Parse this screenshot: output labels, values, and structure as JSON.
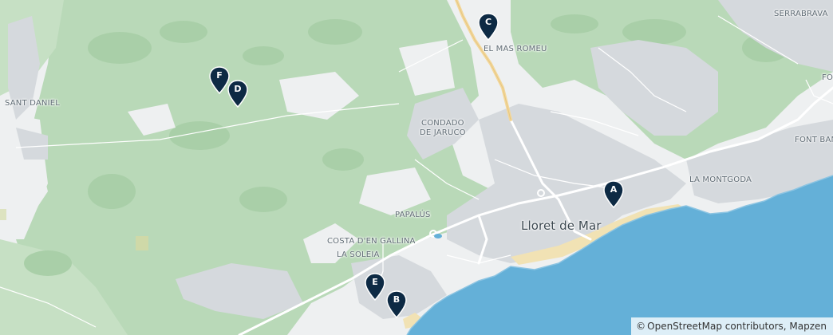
{
  "colors": {
    "land": "#eef0f1",
    "forest": "#b9d9b8",
    "forest_dark": "#a9cfa8",
    "water": "#64b0d8",
    "built": "#d5d9dd",
    "road_major": "#ffffff",
    "highway": "#f3d79a",
    "marker": "#0d2a44",
    "beach": "#f1e2b4"
  },
  "labels": {
    "el_mas_romeu": "EL MAS ROMEU",
    "serrabrava": "SERRABRAVA",
    "fo": "FO",
    "sant_daniel": "SANT DANIEL",
    "condado_line1": "CONDADO",
    "condado_line2": "DE JARUCO",
    "font_ban": "FONT BAN",
    "la_montgoda": "LA MONTGODA",
    "papalus": "PAPALÚS",
    "lloret": "Lloret de Mar",
    "costa_gallina": "COSTA D'EN GALLINA",
    "la_soleia": "LA SOLEIA"
  },
  "markers": [
    {
      "letter": "A"
    },
    {
      "letter": "B"
    },
    {
      "letter": "C"
    },
    {
      "letter": "D"
    },
    {
      "letter": "E"
    },
    {
      "letter": "F"
    }
  ],
  "attribution": {
    "copyright_symbol": "©",
    "text": "OpenStreetMap contributors, Mapzen"
  }
}
